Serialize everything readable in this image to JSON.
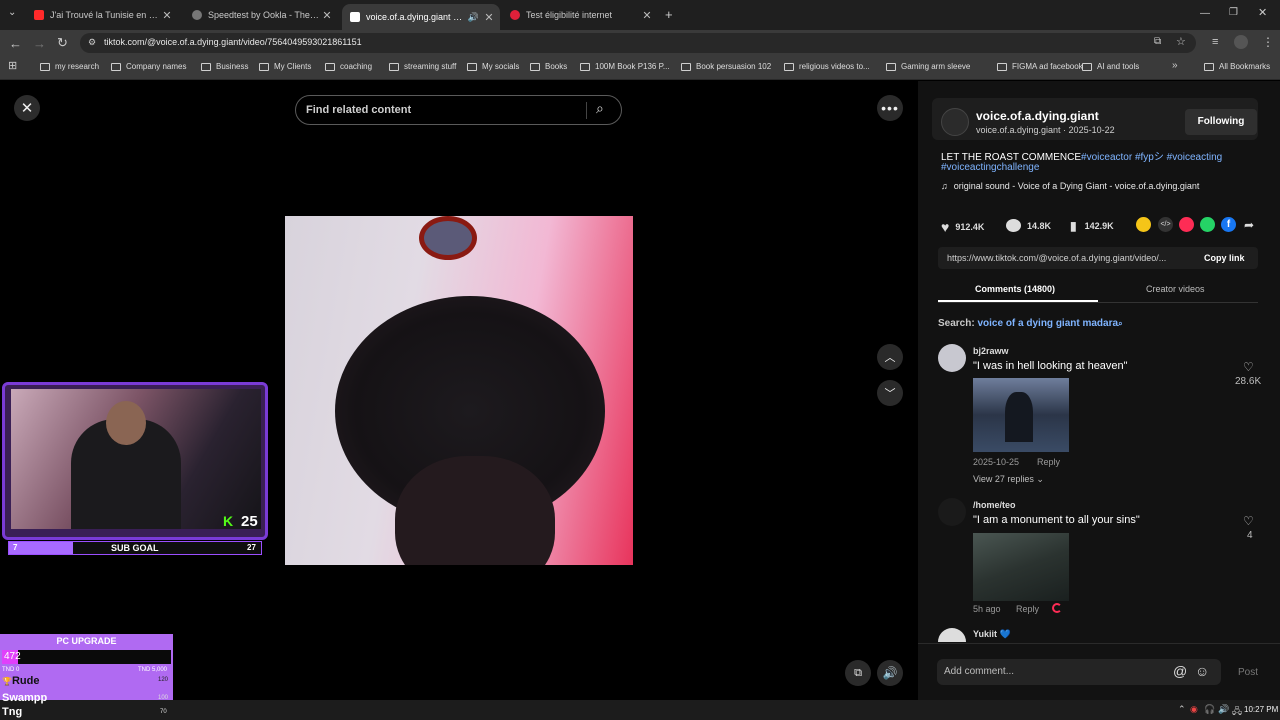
{
  "browser": {
    "tabs": [
      {
        "title": "J'ai Trouvé la Tunisie en Italie",
        "favicon_color": "#ff2a2a"
      },
      {
        "title": "Speedtest by Ookla - The Glob",
        "favicon_color": "#aaaaaa"
      },
      {
        "title": "voice.of.a.dying.giant (@voi",
        "favicon_color": "#ffffff"
      },
      {
        "title": "Test éligibilité internet",
        "favicon_color": "#e0203a"
      }
    ],
    "url": "tiktok.com/@voice.of.a.dying.giant/video/7564049593021861151",
    "bookmarks": [
      "my research",
      "Company names",
      "Business",
      "My Clients",
      "coaching",
      "streaming stuff",
      "My socials",
      "Books",
      "100M Book P136 P...",
      "Book persuasion 102",
      "religious videos to...",
      "Gaming arm sleeve",
      "FIGMA ad facebook",
      "AI and tools"
    ],
    "all_bookmarks": "All Bookmarks"
  },
  "video": {
    "search_placeholder": "Find related content"
  },
  "stream_overlay": {
    "follower_count": "25",
    "sub_goal_label": "SUB GOAL",
    "sub_goal_current": "7",
    "sub_goal_target": "27",
    "pc_upgrade_label": "PC UPGRADE",
    "pc_upgrade_value": "472",
    "pc_upgrade_min": "TND 0",
    "pc_upgrade_max": "TND 5,000",
    "leaderboard": [
      {
        "name": "Rude",
        "score": "120"
      },
      {
        "name": "Swampp",
        "score": "100"
      },
      {
        "name": "Tng",
        "score": "70"
      }
    ]
  },
  "post": {
    "username": "voice.of.a.dying.giant",
    "handle_date": "voice.of.a.dying.giant · 2025-10-22",
    "follow_button": "Following",
    "caption_text": "LET THE ROAST COMMENCE",
    "hashtags_line1": "#voiceactor #fypシ #voiceacting",
    "hashtags_line2": "#voiceactingchallenge",
    "sound": "original sound - Voice of a Dying Giant - voice.of.a.dying.giant",
    "likes": "912.4K",
    "comments": "14.8K",
    "saves": "142.9K",
    "link": "https://www.tiktok.com/@voice.of.a.dying.giant/video/...",
    "copy_link": "Copy link",
    "tab_comments": "Comments (14800)",
    "tab_creator": "Creator videos",
    "search_prefix": "Search:",
    "search_query": "voice of a dying giant madara"
  },
  "comments": [
    {
      "user": "bj2raww",
      "text": "\"I was in hell looking at heaven\"",
      "date": "2025-10-25",
      "reply": "Reply",
      "likes": "28.6K",
      "view_replies": "View 27 replies"
    },
    {
      "user": "/home/teo",
      "text": "\"I am a monument to all your sins\"",
      "date": "5h ago",
      "reply": "Reply",
      "likes": "4"
    },
    {
      "user": "Yukiit 💙"
    }
  ],
  "comment_input": {
    "placeholder": "Add comment...",
    "post": "Post"
  },
  "taskbar": {
    "time": "10:27 PM"
  }
}
